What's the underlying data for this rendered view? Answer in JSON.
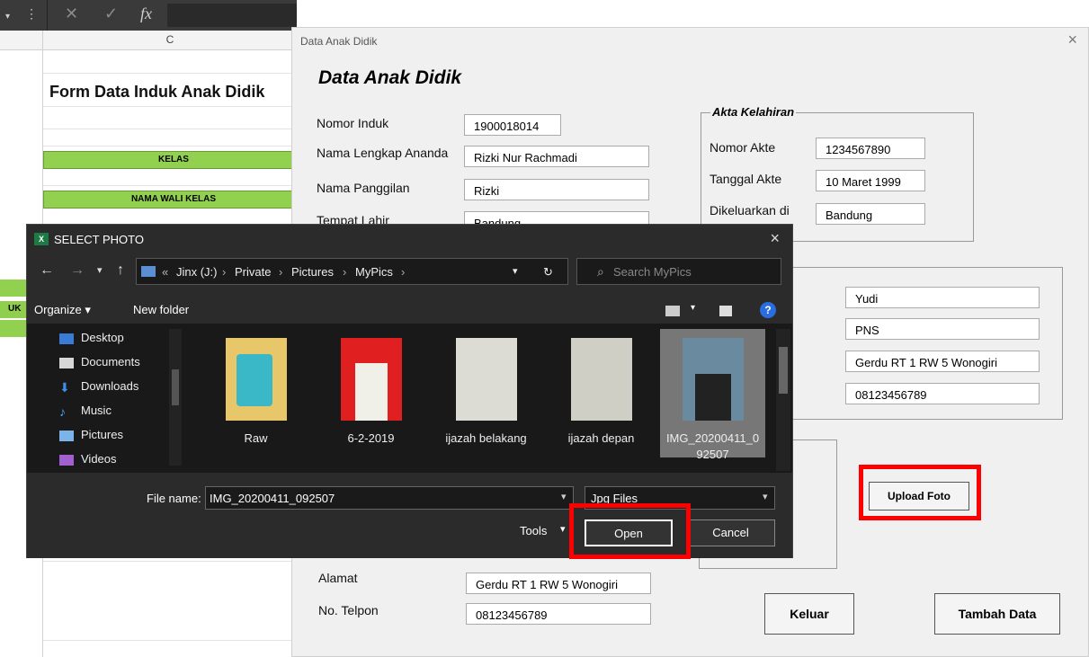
{
  "excel": {
    "column_header": "C",
    "fx_label": "fx",
    "sheet_title": "Form Data Induk Anak Didik",
    "kelas_label": "KELAS",
    "wali_label": "NAMA WALI KELAS",
    "left_row_label": "UK"
  },
  "userform": {
    "window_title": "Data Anak Didik",
    "close_glyph": "×",
    "heading": "Data Anak Didik",
    "fields": [
      {
        "label": "Nomor Induk",
        "value": "1900018014"
      },
      {
        "label": "Nama Lengkap Ananda",
        "value": "Rizki Nur Rachmadi"
      },
      {
        "label": "Nama Panggilan",
        "value": "Rizki"
      },
      {
        "label": "Tempat Lahir",
        "value": "Bandung"
      }
    ],
    "akta": {
      "caption": "Akta Kelahiran",
      "fields": [
        {
          "label": "Nomor Akte",
          "value": "1234567890"
        },
        {
          "label": "Tanggal Akte",
          "value": "10 Maret 1999"
        },
        {
          "label": "Dikeluarkan di",
          "value": "Bandung"
        }
      ]
    },
    "parent_values": [
      "Yudi",
      "PNS",
      "Gerdu RT 1 RW 5 Wonogiri",
      "08123456789"
    ],
    "bottom_fields": [
      {
        "label": "Alamat",
        "value": "Gerdu RT 1 RW 5 Wonogiri"
      },
      {
        "label": "No. Telpon",
        "value": "08123456789"
      }
    ],
    "upload_button": "Upload Foto",
    "keluar_button": "Keluar",
    "tambah_button": "Tambah Data"
  },
  "dialog": {
    "title": "SELECT PHOTO",
    "excel_badge": "X",
    "close_glyph": "×",
    "breadcrumb": [
      "«",
      "Jinx (J:)",
      "Private",
      "Pictures",
      "MyPics"
    ],
    "search_placeholder": "Search MyPics",
    "organize": "Organize ▾",
    "new_folder": "New folder",
    "nav_items": [
      "Desktop",
      "Documents",
      "Downloads",
      "Music",
      "Pictures",
      "Videos"
    ],
    "files": [
      "Raw",
      "6-2-2019",
      "ijazah belakang",
      "ijazah depan",
      "IMG_20200411_0 92507"
    ],
    "file_name_label": "File name:",
    "file_name_value": "IMG_20200411_092507",
    "filter_value": "Jpg Files",
    "tools": "Tools",
    "open": "Open",
    "cancel": "Cancel"
  },
  "colors": {
    "highlight": "#ff0000",
    "excel_green": "#92d050",
    "dialog_bg": "#2b2b2b"
  }
}
